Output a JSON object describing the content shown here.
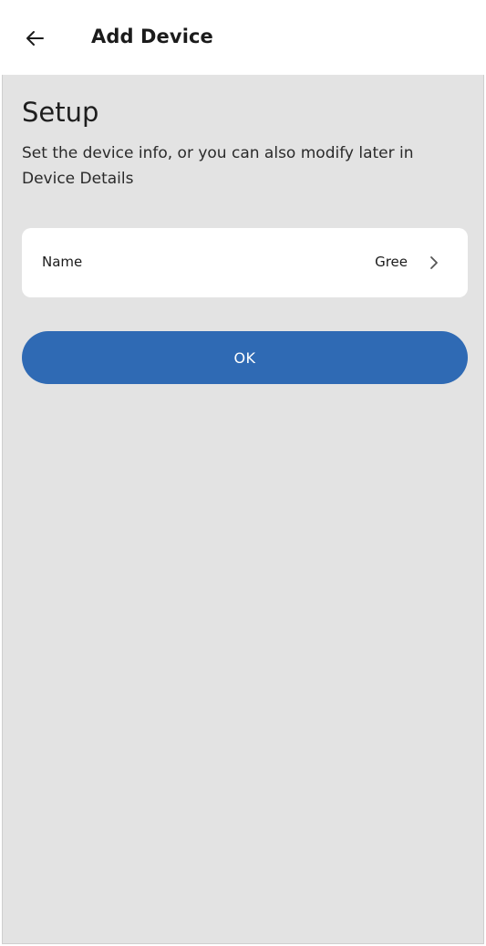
{
  "appbar": {
    "back_icon": "arrow-left-icon",
    "title": "Add Device"
  },
  "setup": {
    "title": "Setup",
    "description": "Set the device info, or you can also modify later in Device Details"
  },
  "name_row": {
    "label": "Name",
    "value": "Gree",
    "chevron_icon": "chevron-right-icon"
  },
  "ok_button": {
    "label": "OK",
    "color": "#2f6ab4"
  },
  "colors": {
    "background": "#e3e3e3",
    "card": "#ffffff",
    "accent": "#2f6ab4"
  }
}
